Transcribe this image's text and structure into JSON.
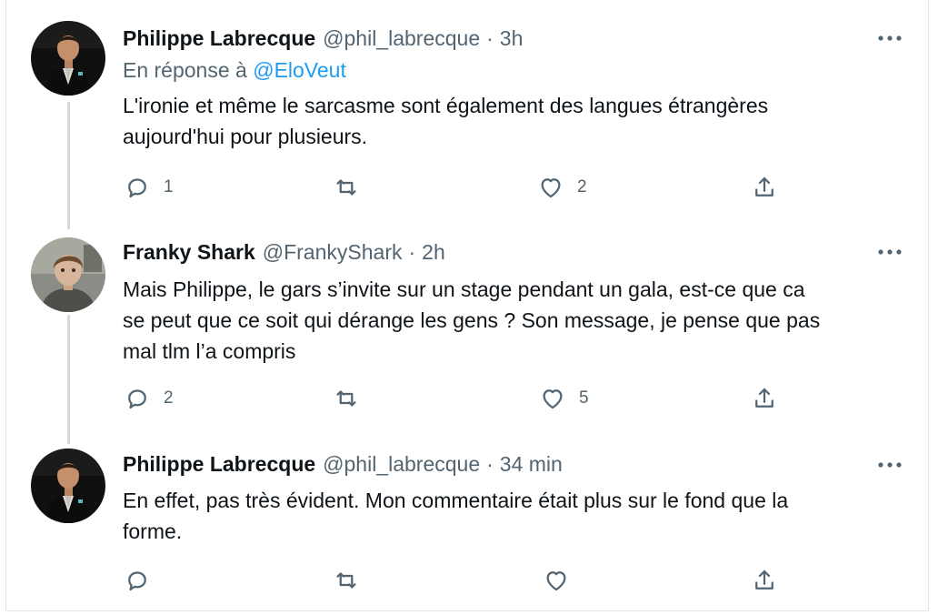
{
  "thread": {
    "tweets": [
      {
        "name": "Philippe Labrecque",
        "handle": "@phil_labrecque",
        "time": "3h",
        "reply_prefix": "En réponse à ",
        "reply_to": "@EloVeut",
        "text_lines": [
          "L'ironie et même le sarcasme sont également des langues étrangères",
          "aujourd'hui pour plusieurs."
        ],
        "reply_count": "1",
        "retweet_count": "",
        "like_count": "2"
      },
      {
        "name": "Franky Shark",
        "handle": "@FrankyShark",
        "time": "2h",
        "text_lines": [
          "Mais Philippe, le gars s’invite sur un stage pendant un gala, est-ce que ca",
          "se peut que ce soit qui dérange les gens ? Son message, je pense que pas",
          "mal tlm l’a compris"
        ],
        "reply_count": "2",
        "retweet_count": "",
        "like_count": "5"
      },
      {
        "name": "Philippe Labrecque",
        "handle": "@phil_labrecque",
        "time": "34 min",
        "text_lines": [
          "En effet, pas très évident. Mon commentaire était plus sur le fond que la",
          "forme."
        ],
        "reply_count": "",
        "retweet_count": "",
        "like_count": ""
      }
    ],
    "separator": "·"
  },
  "icons": {
    "more": "more-horizontal-icon",
    "reply": "reply-bubble-icon",
    "retweet": "retweet-icon",
    "like": "heart-icon",
    "share": "share-upload-icon"
  },
  "colors": {
    "text": "#0f1419",
    "secondary": "#536471",
    "link": "#1d9bf0",
    "thread_line": "#cfd9de"
  }
}
